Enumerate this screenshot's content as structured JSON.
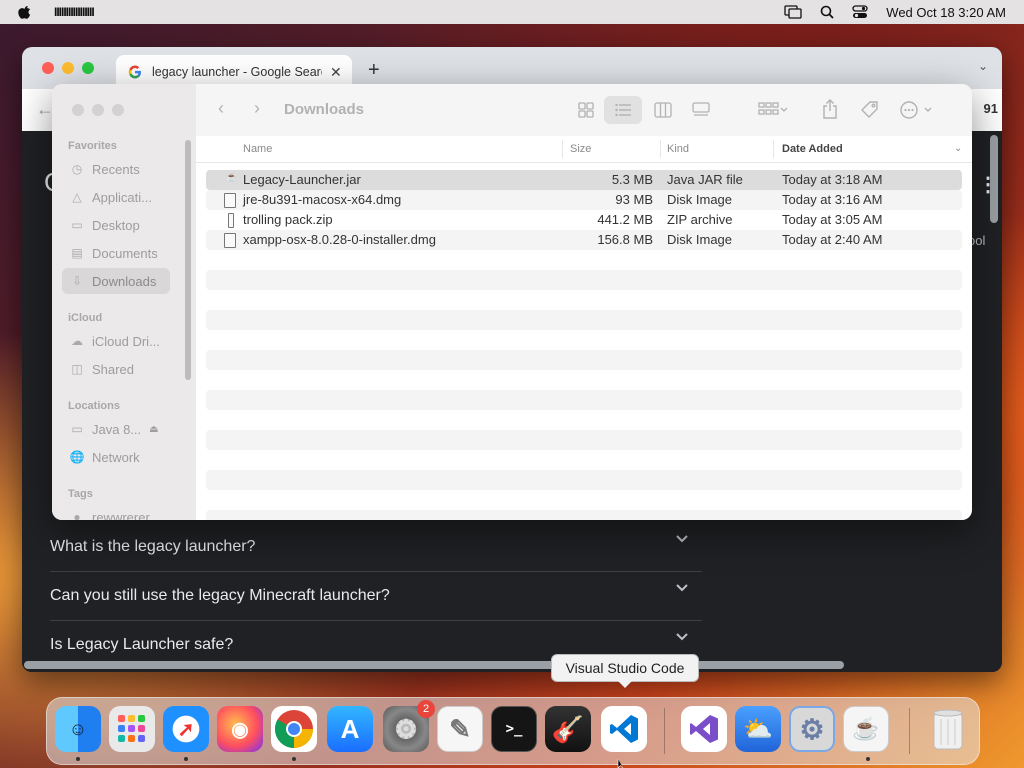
{
  "menubar": {
    "app_name": "IIIIIIIIIIIIIIIII",
    "datetime": "Wed Oct 18  3:20 AM"
  },
  "chrome": {
    "tab_title": "legacy launcher - Google Search",
    "new_tab": "+",
    "close": "✕",
    "faq": [
      {
        "question": "What is the legacy launcher?"
      },
      {
        "question": "Can you still use the legacy Minecraft launcher?"
      },
      {
        "question": "Is Legacy Launcher safe?"
      }
    ],
    "partial_text_right": "ool",
    "partial_text_top": "91"
  },
  "finder": {
    "title": "Downloads",
    "sidebar": {
      "favorites_header": "Favorites",
      "favorites": [
        {
          "label": "Recents",
          "icon": "clock-icon"
        },
        {
          "label": "Applicati...",
          "icon": "applications-icon"
        },
        {
          "label": "Desktop",
          "icon": "desktop-icon"
        },
        {
          "label": "Documents",
          "icon": "document-icon"
        },
        {
          "label": "Downloads",
          "icon": "download-icon"
        }
      ],
      "icloud_header": "iCloud",
      "icloud": [
        {
          "label": "iCloud Dri...",
          "icon": "cloud-icon"
        },
        {
          "label": "Shared",
          "icon": "shared-folder-icon"
        }
      ],
      "locations_header": "Locations",
      "locations": [
        {
          "label": "Java 8...",
          "icon": "disk-icon"
        },
        {
          "label": "Network",
          "icon": "network-icon"
        }
      ],
      "tags_header": "Tags",
      "tags": [
        {
          "label": "rewwrerer"
        }
      ]
    },
    "columns": {
      "name": "Name",
      "size": "Size",
      "kind": "Kind",
      "date": "Date Added"
    },
    "files": [
      {
        "name": "Legacy-Launcher.jar",
        "size": "5.3 MB",
        "kind": "Java JAR file",
        "date": "Today at 3:18 AM"
      },
      {
        "name": "jre-8u391-macosx-x64.dmg",
        "size": "93 MB",
        "kind": "Disk Image",
        "date": "Today at 3:16 AM"
      },
      {
        "name": "trolling pack.zip",
        "size": "441.2 MB",
        "kind": "ZIP archive",
        "date": "Today at 3:05 AM"
      },
      {
        "name": "xampp-osx-8.0.28-0-installer.dmg",
        "size": "156.8 MB",
        "kind": "Disk Image",
        "date": "Today at 2:40 AM"
      }
    ]
  },
  "tooltip": {
    "text": "Visual Studio Code"
  },
  "dock": {
    "items": [
      {
        "name": "Finder",
        "icon": "finder-icon",
        "color": "#2d8cf0"
      },
      {
        "name": "Launchpad",
        "icon": "launchpad-icon",
        "color": "#e9e9e9"
      },
      {
        "name": "Safari",
        "icon": "safari-icon",
        "color": "#1e90ff"
      },
      {
        "name": "Firefox",
        "icon": "firefox-icon",
        "color": "#ff7139"
      },
      {
        "name": "Chrome",
        "icon": "chrome-icon",
        "color": "#ffffff"
      },
      {
        "name": "App Store",
        "icon": "appstore-icon",
        "color": "#1a8cff"
      },
      {
        "name": "System Preferences",
        "icon": "gear-icon",
        "color": "#8e8e93",
        "badge": "2"
      },
      {
        "name": "TextEdit",
        "icon": "textedit-icon",
        "color": "#f3f3f3"
      },
      {
        "name": "Terminal",
        "icon": "terminal-icon",
        "color": "#1c1c1c"
      },
      {
        "name": "Instruments",
        "icon": "guitar-icon",
        "color": "#2a2a2a"
      },
      {
        "name": "Visual Studio Code",
        "icon": "vscode-icon",
        "color": "#ffffff"
      },
      {
        "name": "Visual Studio",
        "icon": "visual-studio-icon",
        "color": "#ffffff"
      },
      {
        "name": "Weather",
        "icon": "weather-icon",
        "color": "#2f7de1"
      },
      {
        "name": "System Settings",
        "icon": "settings-icon",
        "color": "#dcdcdc"
      },
      {
        "name": "Java",
        "icon": "java-icon",
        "color": "#f5f5f5"
      },
      {
        "name": "Trash",
        "icon": "trash-icon",
        "color": "#e5e5e5"
      }
    ]
  }
}
